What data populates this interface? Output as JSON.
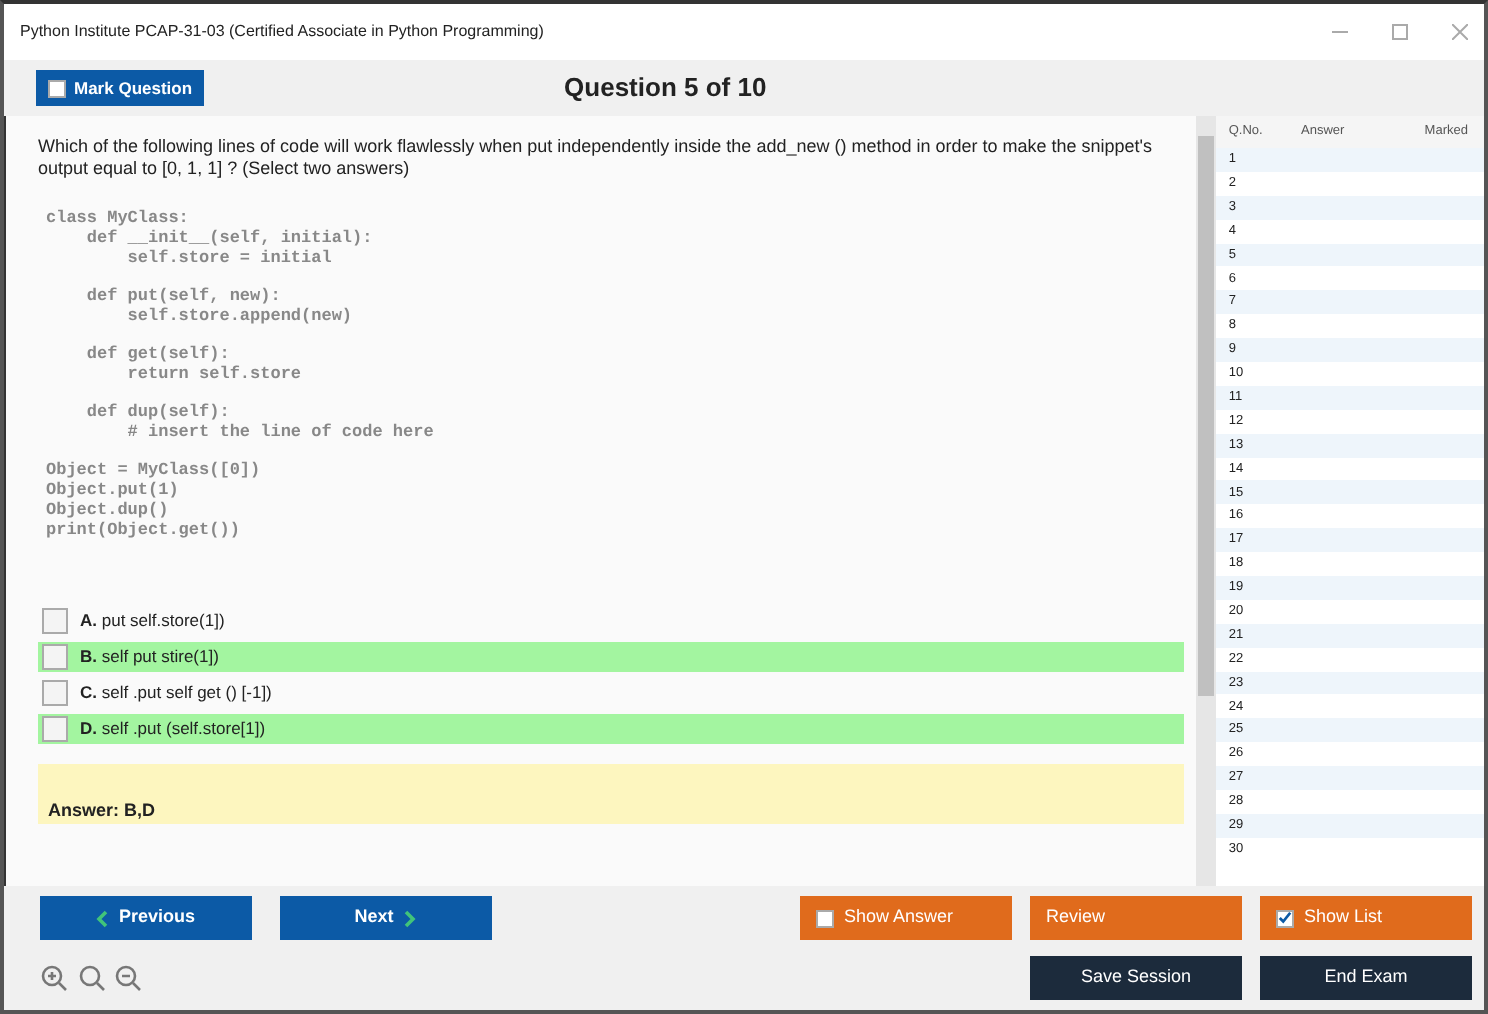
{
  "window": {
    "title": "Python Institute PCAP-31-03 (Certified Associate in Python Programming)"
  },
  "header": {
    "mark_button": {
      "label": "Mark Question",
      "checked": false
    },
    "title": "Question 5 of 10"
  },
  "question": {
    "text": "Which of the following lines of code will work flawlessly when put independently inside the add_new () method in order to make the snippet's output equal to [0, 1, 1] ? (Select two answers)",
    "code_blocks": [
      [
        "class MyClass:",
        "    def __init__(self, initial):",
        "        self.store = initial"
      ],
      [
        "    def put(self, new):",
        "        self.store.append(new)"
      ],
      [
        "    def get(self):",
        "        return self.store"
      ],
      [
        "    def dup(self):",
        "        # insert the line of code here"
      ],
      [
        "Object = MyClass([0])",
        "Object.put(1)",
        "Object.dup()",
        "print(Object.get())"
      ]
    ],
    "options": [
      {
        "letter": "A.",
        "text": "put self.store(1])",
        "checked": false,
        "highlighted": false
      },
      {
        "letter": "B.",
        "text": "self put stire(1])",
        "checked": false,
        "highlighted": true
      },
      {
        "letter": "C.",
        "text": "self .put self get () [-1])",
        "checked": false,
        "highlighted": false
      },
      {
        "letter": "D.",
        "text": "self .put (self.store[1])",
        "checked": false,
        "highlighted": true
      }
    ],
    "answer": "Answer: B,D"
  },
  "question_list": {
    "columns": [
      "Q.No.",
      "Answer",
      "Marked"
    ],
    "rows": [
      "1",
      "2",
      "3",
      "4",
      "5",
      "6",
      "7",
      "8",
      "9",
      "10",
      "11",
      "12",
      "13",
      "14",
      "15",
      "16",
      "17",
      "18",
      "19",
      "20",
      "21",
      "22",
      "23",
      "24",
      "25",
      "26",
      "27",
      "28",
      "29",
      "30"
    ]
  },
  "footer": {
    "previous": "Previous",
    "next": "Next",
    "show_answer": {
      "label": "Show Answer",
      "checked": false
    },
    "review": "Review",
    "show_list": {
      "label": "Show List",
      "checked": true
    },
    "save_session": "Save Session",
    "end_exam": "End Exam"
  }
}
